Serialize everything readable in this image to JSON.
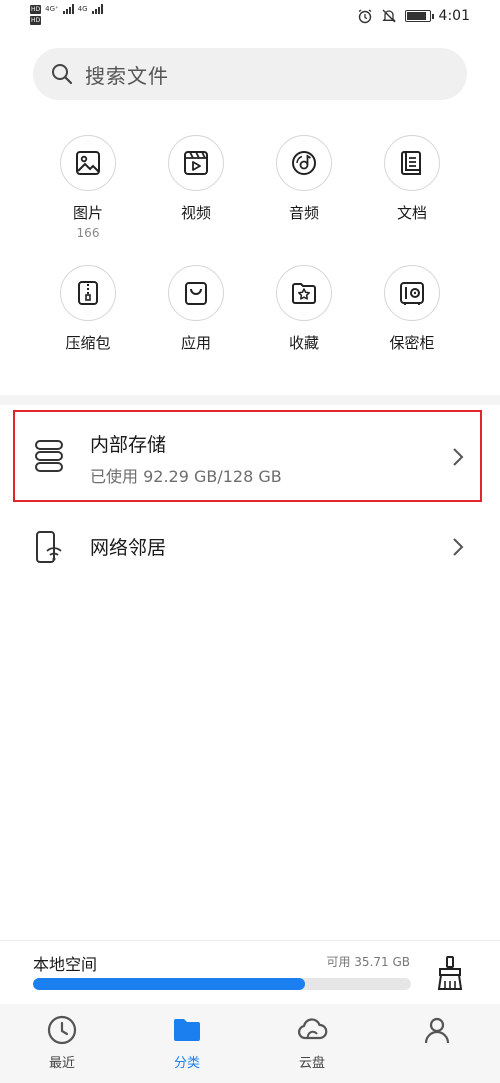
{
  "status_bar": {
    "left_line1": "4G⁺",
    "left_line2": "4G",
    "hd": "HD",
    "time": "4:01"
  },
  "search": {
    "placeholder": "搜索文件"
  },
  "categories": [
    {
      "label": "图片",
      "count": "166",
      "icon": "image-icon"
    },
    {
      "label": "视频",
      "icon": "video-icon"
    },
    {
      "label": "音频",
      "icon": "audio-icon"
    },
    {
      "label": "文档",
      "icon": "document-icon"
    },
    {
      "label": "压缩包",
      "icon": "archive-icon"
    },
    {
      "label": "应用",
      "icon": "app-bag-icon"
    },
    {
      "label": "收藏",
      "icon": "favorite-folder-icon"
    },
    {
      "label": "保密柜",
      "icon": "safe-icon"
    }
  ],
  "internal_storage": {
    "title": "内部存储",
    "usage": "已使用 92.29 GB/128 GB"
  },
  "network_neighbors": {
    "title": "网络邻居"
  },
  "local_space": {
    "title": "本地空间",
    "available": "可用 35.71 GB",
    "used_fraction": 0.72
  },
  "tabs": [
    {
      "label": "最近",
      "icon": "clock-icon",
      "active": false
    },
    {
      "label": "分类",
      "icon": "folder-icon",
      "active": true
    },
    {
      "label": "云盘",
      "icon": "cloud-icon",
      "active": false
    },
    {
      "label": "",
      "icon": "profile-icon",
      "active": false
    }
  ],
  "colors": {
    "accent": "#1b7ff0",
    "highlight_border": "#e0262b"
  }
}
